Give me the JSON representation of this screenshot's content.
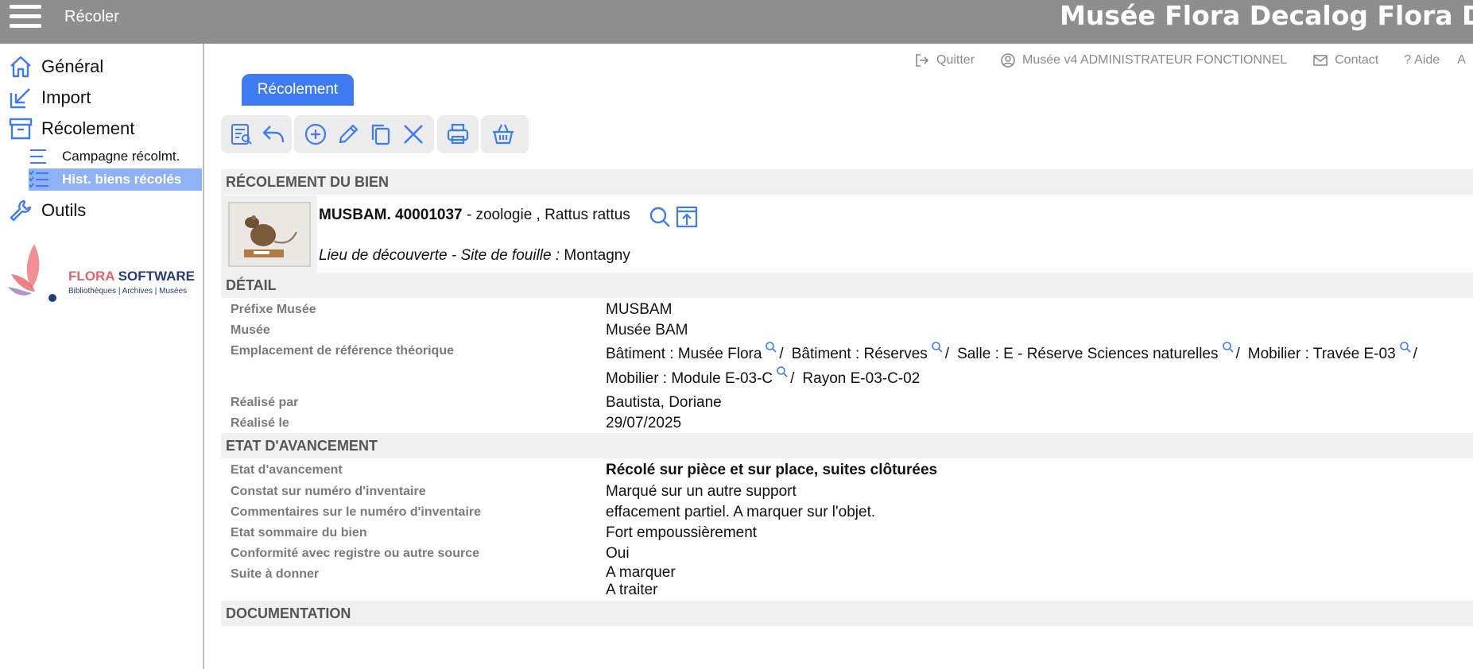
{
  "topbar": {
    "title": "Récoler",
    "app_name": "Musée Flora Decalog Flora DEMO v"
  },
  "sidebar": {
    "items": [
      {
        "label": "Général",
        "icon": "home-icon"
      },
      {
        "label": "Import",
        "icon": "import-icon"
      },
      {
        "label": "Récolement",
        "icon": "archive-box-icon"
      },
      {
        "label": "Outils",
        "icon": "wrench-icon"
      }
    ],
    "sub_items": [
      {
        "label": "Campagne récolmt.",
        "icon": "list-icon",
        "active": false
      },
      {
        "label": "Hist. biens récolés",
        "icon": "checklist-icon",
        "active": true
      }
    ],
    "logo": {
      "brand_accent": "FLORA",
      "brand_rest": " SOFTWARE",
      "tagline": "Bibliothèques | Archives | Musées"
    }
  },
  "header_links": {
    "quit": "Quitter",
    "user": "Musée v4 ADMINISTRATEUR FONCTIONNEL",
    "contact": "Contact",
    "help": "Aide",
    "extra": "A"
  },
  "tab": {
    "label": "Récolement"
  },
  "toolbar": {
    "groups": [
      [
        "list-search-icon",
        "undo-icon"
      ],
      [
        "add-circle-icon",
        "edit-pencil-icon",
        "copy-icon",
        "delete-x-icon"
      ],
      [
        "print-icon"
      ],
      [
        "basket-icon"
      ]
    ]
  },
  "sections": {
    "recolement": "RÉCOLEMENT DU BIEN",
    "detail": "DÉTAIL",
    "etat": "ETAT D'AVANCEMENT",
    "documentation": "DOCUMENTATION"
  },
  "object": {
    "inventory_number": "MUSBAM. 40001037",
    "description": " - zoologie , Rattus rattus",
    "place_label": "Lieu de découverte - Site de fouille :",
    "place_value": " Montagny"
  },
  "detail": {
    "prefix_label": "Préfixe Musée",
    "prefix_value": "MUSBAM",
    "museum_label": "Musée",
    "museum_value": "Musée BAM",
    "location_label": "Emplacement de référence théorique",
    "location_line1": [
      {
        "text": "Bâtiment : Musée Flora",
        "search": true
      },
      {
        "text": "Bâtiment : Réserves",
        "search": true
      },
      {
        "text": "Salle : E - Réserve Sciences naturelles",
        "search": true
      },
      {
        "text": "Mobilier : Travée E-03",
        "search": true
      }
    ],
    "location_line2": [
      {
        "text": "Mobilier : Module E-03-C",
        "search": true
      },
      {
        "text": "Rayon E-03-C-02",
        "search": false
      }
    ],
    "separator": "/",
    "done_by_label": "Réalisé par",
    "done_by_value": "Bautista, Doriane",
    "done_on_label": "Réalisé le",
    "done_on_value": "29/07/2025"
  },
  "etat": {
    "progress_label": "Etat d'avancement",
    "progress_value": "Récolé sur pièce et sur place, suites clôturées",
    "inv_check_label": "Constat sur numéro d'inventaire",
    "inv_check_value": "Marqué sur un autre support",
    "inv_comment_label": "Commentaires sur le numéro d'inventaire",
    "inv_comment_value": "effacement partiel. A marquer sur l'objet.",
    "summary_label": "Etat sommaire du bien",
    "summary_value": "Fort empoussièrement",
    "conformity_label": "Conformité avec registre ou autre source",
    "conformity_value": "Oui",
    "followup_label": "Suite à donner",
    "followup_values": [
      "A marquer",
      "A traiter"
    ]
  },
  "colors": {
    "topbar": "#8e8e8e",
    "accent": "#3e7bf2",
    "active_nav": "#8fb1f5",
    "section_bg": "#f0f0f0",
    "label_gray": "#7a7a7a"
  }
}
